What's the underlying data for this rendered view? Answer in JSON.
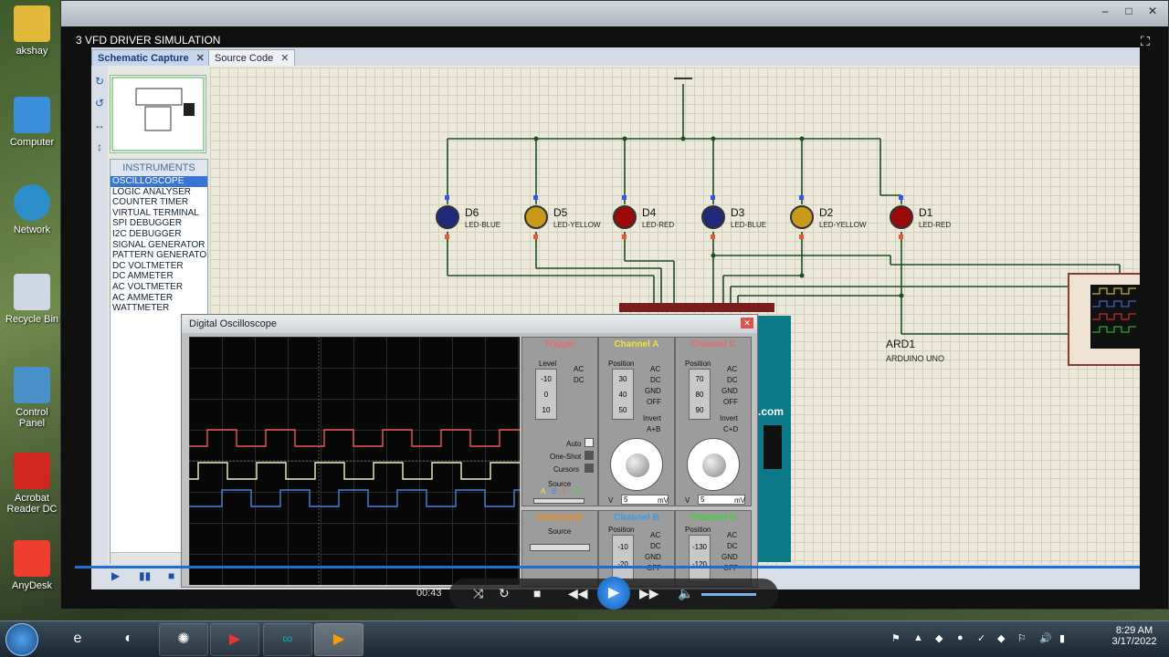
{
  "desktop": {
    "icons": [
      {
        "label": "akshay"
      },
      {
        "label": "Computer"
      },
      {
        "label": "Network"
      },
      {
        "label": "Recycle Bin"
      },
      {
        "label": "Control Panel"
      },
      {
        "label": "Acrobat Reader DC"
      },
      {
        "label": "AnyDesk"
      }
    ]
  },
  "window": {
    "title": "3 VFD DRIVER SIMULATION"
  },
  "tabs": [
    {
      "label": "Schematic Capture"
    },
    {
      "label": "Source Code"
    }
  ],
  "instruments": {
    "header": "INSTRUMENTS",
    "items": [
      "OSCILLOSCOPE",
      "LOGIC ANALYSER",
      "COUNTER TIMER",
      "VIRTUAL TERMINAL",
      "SPI DEBUGGER",
      "I2C DEBUGGER",
      "SIGNAL GENERATOR",
      "PATTERN GENERATO",
      "DC VOLTMETER",
      "DC AMMETER",
      "AC VOLTMETER",
      "AC AMMETER",
      "WATTMETER"
    ]
  },
  "leds": [
    {
      "ref": "D6",
      "type": "LED-BLUE",
      "color": "#1f2a7a"
    },
    {
      "ref": "D5",
      "type": "LED-YELLOW",
      "color": "#c79a1a"
    },
    {
      "ref": "D4",
      "type": "LED-RED",
      "color": "#9a0a0a"
    },
    {
      "ref": "D3",
      "type": "LED-BLUE",
      "color": "#1f2a7a"
    },
    {
      "ref": "D2",
      "type": "LED-YELLOW",
      "color": "#c79a1a"
    },
    {
      "ref": "D1",
      "type": "LED-RED",
      "color": "#9a0a0a"
    }
  ],
  "ard": {
    "ref": "ARD1",
    "type": "ARDUINO UNO"
  },
  "scope_inputs": [
    "A",
    "B",
    "C",
    "D"
  ],
  "scope": {
    "title": "Digital Oscilloscope",
    "trigger": {
      "title": "Trigger",
      "level": "Level",
      "ac": "AC",
      "dc": "DC",
      "level_values": [
        "-10",
        "0",
        "10"
      ],
      "auto": "Auto",
      "oneshot": "One-Shot",
      "cursors": "Cursors",
      "source": "Source",
      "source_letters": [
        "A",
        "B",
        "C",
        "D"
      ]
    },
    "channel_a": {
      "title": "Channel A",
      "position": "Position",
      "values": [
        "30",
        "40",
        "50"
      ],
      "ac": "AC",
      "dc": "DC",
      "gnd": "GND",
      "off": "OFF",
      "invert": "Invert",
      "sum": "A+B",
      "unit_v": "V",
      "value": "5",
      "unit_mv": "mV"
    },
    "channel_c": {
      "title": "Channel C",
      "position": "Position",
      "values": [
        "70",
        "80",
        "90"
      ],
      "ac": "AC",
      "dc": "DC",
      "gnd": "GND",
      "off": "OFF",
      "invert": "Invert",
      "sum": "C+D",
      "unit_v": "V",
      "value": "5",
      "unit_mv": "mV"
    },
    "horizontal": {
      "title": "Horizontal",
      "source": "Source"
    },
    "channel_b": {
      "title": "Channel B",
      "position": "Position",
      "values": [
        "-10",
        "-20"
      ],
      "ac": "AC",
      "dc": "DC",
      "gnd": "GND",
      "off": "OFF"
    },
    "channel_d": {
      "title": "Channel D",
      "position": "Position",
      "values": [
        "-130",
        "-120"
      ],
      "ac": "AC",
      "dc": "DC",
      "gnd": "GND",
      "off": "OFF"
    },
    "title_colors": {
      "trigger": "#e86a6a",
      "a": "#f2e03a",
      "c": "#e86a6a",
      "horizontal": "#e88a1a",
      "b": "#3a9ae8",
      "d": "#3ad63a"
    }
  },
  "media": {
    "time": "00:43"
  },
  "taskbar": {
    "clock_time": "8:29 AM",
    "clock_date": "3/17/2022"
  }
}
